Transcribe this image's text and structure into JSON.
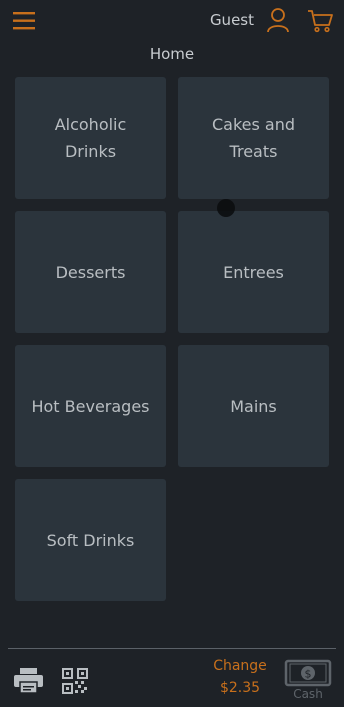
{
  "header": {
    "user_label": "Guest",
    "accent_color": "#c8701c"
  },
  "page": {
    "title": "Home"
  },
  "categories": [
    {
      "label": "Alcoholic Drinks"
    },
    {
      "label": "Cakes and Treats"
    },
    {
      "label": "Desserts"
    },
    {
      "label": "Entrees"
    },
    {
      "label": "Hot Beverages"
    },
    {
      "label": "Mains"
    },
    {
      "label": "Soft Drinks"
    }
  ],
  "footer": {
    "change_label": "Change",
    "change_amount": "$2.35",
    "cash_label": "Cash",
    "icons": [
      "printer-icon",
      "qr-code-icon",
      "cash-icon"
    ]
  },
  "colors": {
    "background": "#1e2227",
    "tile": "#2b343c",
    "text": "#b9bec2",
    "muted": "#5e646a"
  }
}
